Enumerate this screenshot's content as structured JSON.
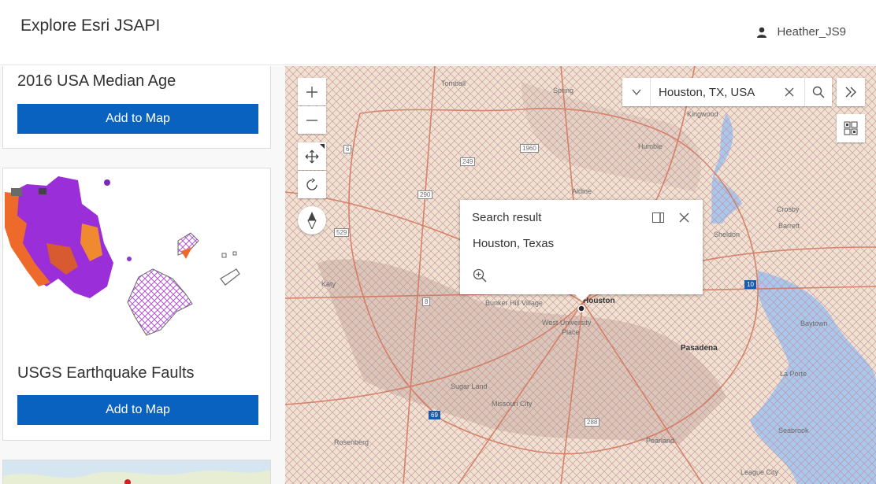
{
  "app": {
    "title": "Explore Esri JSAPI"
  },
  "user": {
    "name": "Heather_JS9"
  },
  "cards": [
    {
      "title": "2016 USA Median Age",
      "button_label": "Add to Map"
    },
    {
      "title": "USGS Earthquake Faults",
      "button_label": "Add to Map"
    }
  ],
  "map": {
    "search": {
      "value": "Houston, TX, USA"
    },
    "popup": {
      "title": "Search result",
      "content": "Houston, Texas"
    },
    "labels": {
      "tomball": "Tomball",
      "spring": "Spring",
      "kingwood": "Kingwood",
      "humble": "Humble",
      "aldine": "Aldine",
      "crosby": "Crosby",
      "barrett": "Barrett",
      "sheldon": "Sheldon",
      "katy": "Katy",
      "bunker_hill": "Bunker Hill Village",
      "houston": "Houston",
      "west_university": "West University",
      "place": "Place",
      "pasadena": "Pasadena",
      "baytown": "Baytown",
      "la_porte": "La Porte",
      "sugar_land": "Sugar Land",
      "missouri_city": "Missouri City",
      "pearland": "Pearland",
      "seabrook": "Seabrook",
      "rosenberg": "Rosenberg",
      "league_city": "League City"
    },
    "shields": {
      "s1960": "1960",
      "s249": "249",
      "s290": "290",
      "s529": "529",
      "s6": "6",
      "s8": "8",
      "s10": "10",
      "s69": "69",
      "s288": "288"
    }
  },
  "colors": {
    "accent": "#0a62c0",
    "hatch": "#c98aa0",
    "water": "#a8c8ec"
  }
}
